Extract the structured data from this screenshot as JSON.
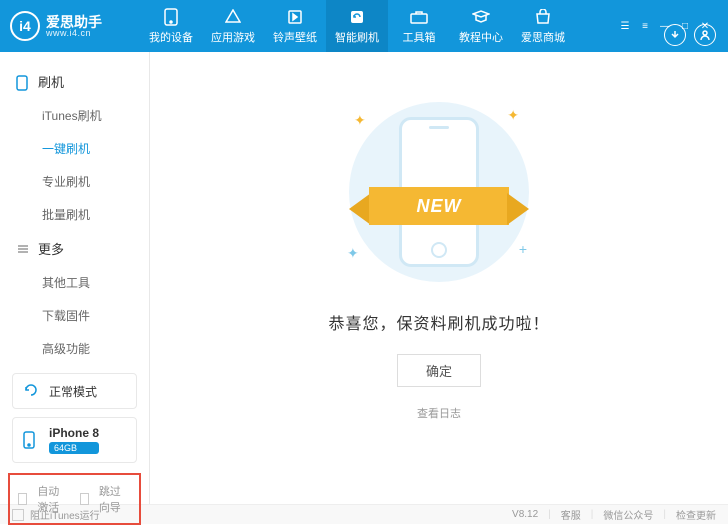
{
  "brand": {
    "cn": "爱思助手",
    "en": "www.i4.cn",
    "logo": "i4"
  },
  "nav": [
    {
      "label": "我的设备",
      "icon": "phone"
    },
    {
      "label": "应用游戏",
      "icon": "apps"
    },
    {
      "label": "铃声壁纸",
      "icon": "music"
    },
    {
      "label": "智能刷机",
      "icon": "flash",
      "active": true
    },
    {
      "label": "工具箱",
      "icon": "toolbox"
    },
    {
      "label": "教程中心",
      "icon": "edu"
    },
    {
      "label": "爱思商城",
      "icon": "shop"
    }
  ],
  "sidebar": {
    "sections": [
      {
        "title": "刷机",
        "icon": "phone",
        "items": [
          {
            "label": "iTunes刷机"
          },
          {
            "label": "一键刷机",
            "active": true
          },
          {
            "label": "专业刷机"
          },
          {
            "label": "批量刷机"
          }
        ]
      },
      {
        "title": "更多",
        "icon": "more",
        "items": [
          {
            "label": "其他工具"
          },
          {
            "label": "下载固件"
          },
          {
            "label": "高级功能"
          }
        ]
      }
    ],
    "status": {
      "label": "正常模式"
    },
    "device": {
      "name": "iPhone 8",
      "storage": "64GB"
    },
    "options": {
      "auto_activate": "自动激活",
      "skip_guide": "跳过向导"
    }
  },
  "content": {
    "ribbon": "NEW",
    "message": "恭喜您，保资料刷机成功啦！",
    "ok": "确定",
    "view_log": "查看日志"
  },
  "footer": {
    "block_itunes": "阻止iTunes运行",
    "version": "V8.12",
    "links": [
      "客服",
      "微信公众号",
      "检查更新"
    ]
  }
}
